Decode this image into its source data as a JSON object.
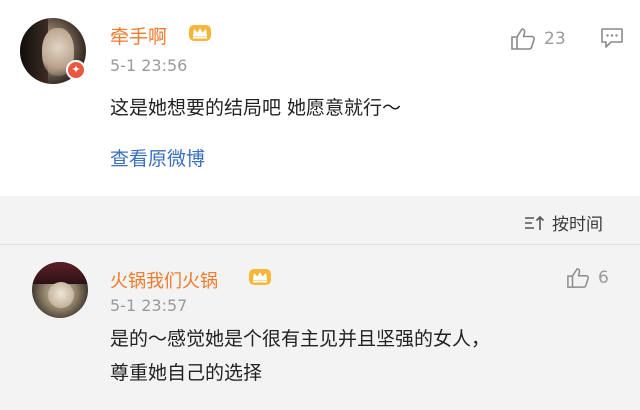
{
  "comments": [
    {
      "username": "牵手啊",
      "time": "5-1 23:56",
      "text": "这是她想要的结局吧 她愿意就行～",
      "likes": "23",
      "view_original": "查看原微博"
    },
    {
      "username": "火锅我们火锅",
      "time": "5-1 23:57",
      "text_lines": [
        "是的～感觉她是个很有主见并且坚强的女人，",
        "尊重她自己的选择"
      ],
      "likes": "6"
    }
  ],
  "sort": {
    "label": "按时间",
    "icon": "sort-icon"
  },
  "colors": {
    "username": "#f07a2b",
    "link": "#3a6fc0",
    "meta": "#9a9a9a",
    "text": "#222222",
    "section_bg": "#f3f3f3"
  }
}
